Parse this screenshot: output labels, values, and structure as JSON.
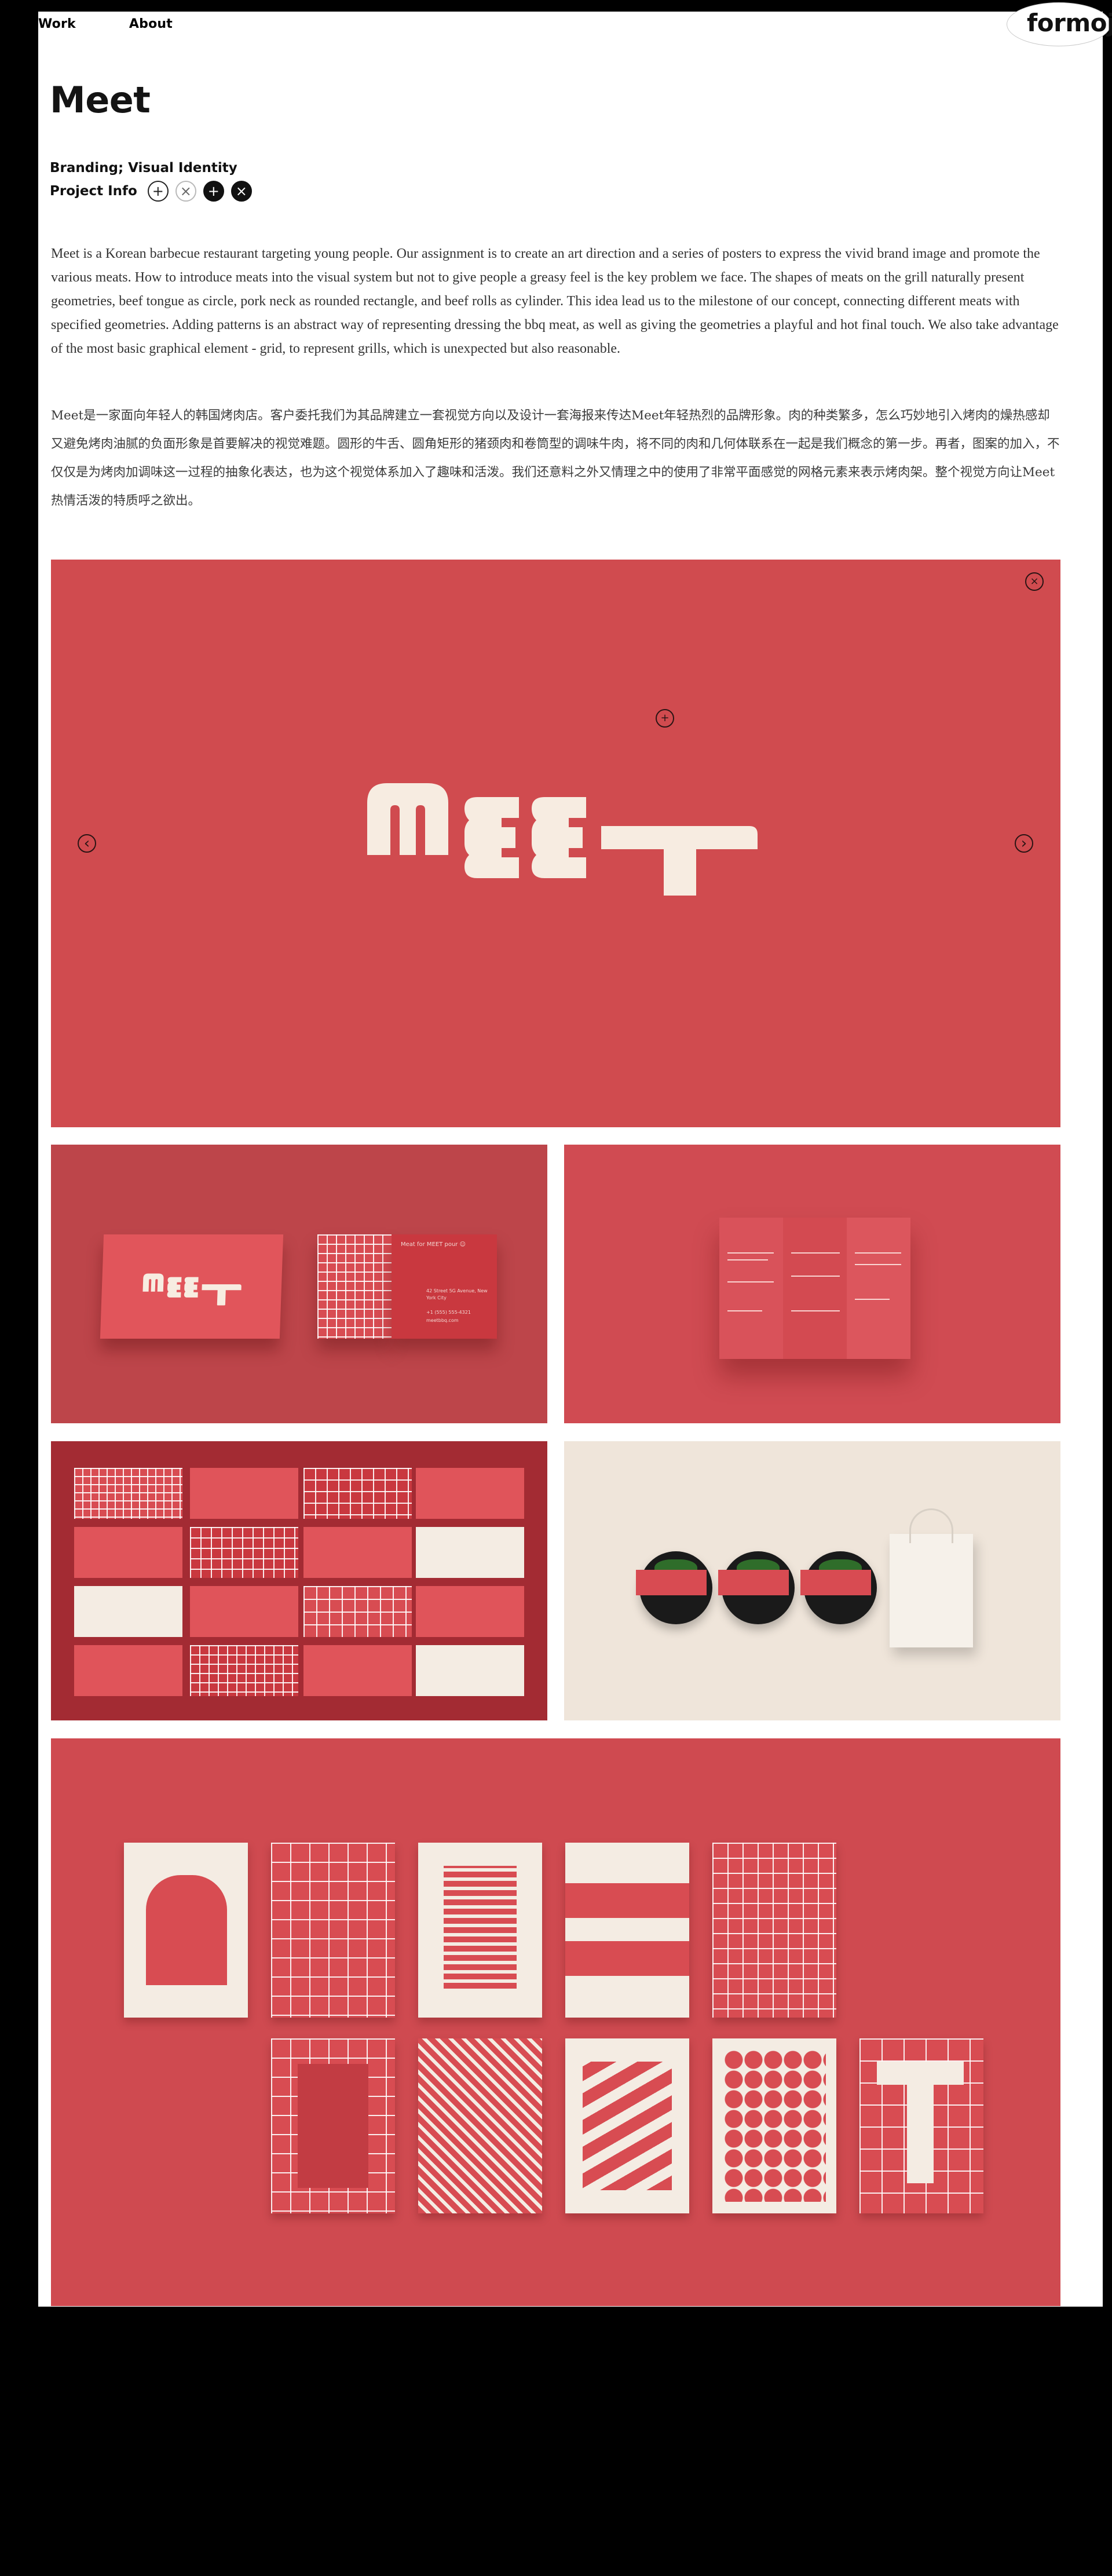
{
  "nav": {
    "work": "Work",
    "about": "About",
    "logo": "formoj"
  },
  "project": {
    "title": "Meet",
    "subtitle": "Branding; Visual Identity",
    "info_label": "Project Info"
  },
  "description": {
    "en": "Meet is a Korean barbecue restaurant targeting young people. Our assignment is to create an art direction and a series of posters to express the vivid brand image and promote the various meats. How to introduce meats into the visual system but not to give people a greasy feel is the key problem we face. The shapes of meats on the grill naturally present geometries, beef tongue as circle, pork neck as rounded rectangle, and beef rolls as cylinder. This idea lead us to the milestone of our concept, connecting different meats with specified  geometries. Adding patterns is an abstract way of representing dressing the bbq meat, as well as giving the geometries a playful and hot final touch. We also take advantage of the most basic graphical element - grid, to represent grills, which is unexpected but also reasonable.",
    "cn": "Meet是一家面向年轻人的韩国烤肉店。客户委托我们为其品牌建立一套视觉方向以及设计一套海报来传达Meet年轻热烈的品牌形象。肉的种类繁多，怎么巧妙地引入烤肉的燥热感却又避免烤肉油腻的负面形象是首要解决的视觉难题。圆形的牛舌、圆角矩形的猪颈肉和卷筒型的调味牛肉，将不同的肉和几何体联系在一起是我们概念的第一步。再者，图案的加入，不仅仅是为烤肉加调味这一过程的抽象化表达，也为这个视觉体系加入了趣味和活泼。我们还意料之外又情理之中的使用了非常平面感觉的网格元素来表示烤肉架。整个视觉方向让Meet热情活泼的特质呼之欲出。"
  },
  "gallery": {
    "hero_wordmark": "meet",
    "card_back_title": "Meat for MEET pour ☺",
    "card_back_address": "42 Street 5G Avenue, New York City",
    "card_back_phone": "+1 (555) 555-4321",
    "card_back_web": "meetbbq.com"
  },
  "colors": {
    "brand_red": "#d04b4f",
    "cream": "#f2e9df",
    "panel_dark": "#a32b33",
    "text": "#333333"
  },
  "icons": {
    "plus": "+",
    "close": "×",
    "prev": "‹",
    "next": "›"
  }
}
